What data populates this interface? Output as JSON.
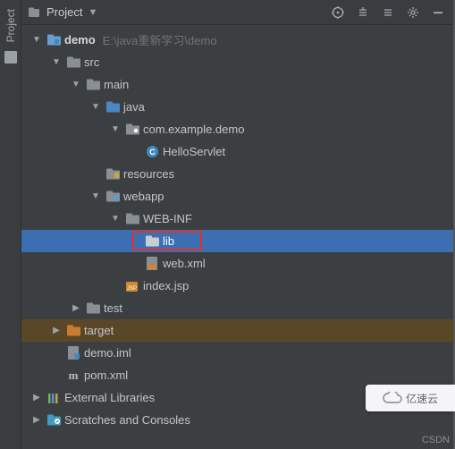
{
  "sidebar_tab": "Project",
  "toolbar": {
    "title": "Project"
  },
  "tree": {
    "root": {
      "name": "demo",
      "path": "E:\\java重新学习\\demo"
    },
    "src": "src",
    "main": "main",
    "java": "java",
    "package": "com.example.demo",
    "class1": "HelloServlet",
    "resources": "resources",
    "webapp": "webapp",
    "webinf": "WEB-INF",
    "lib": "lib",
    "webxml": "web.xml",
    "indexjsp": "index.jsp",
    "test": "test",
    "target": "target",
    "iml": "demo.iml",
    "pom": "pom.xml",
    "extlib": "External Libraries",
    "scratches": "Scratches and Consoles"
  },
  "watermarks": {
    "csdn": "CSDN",
    "cloud": "亿速云"
  },
  "icons": {
    "module": "module-folder",
    "folder": "folder",
    "folder_src": "source-folder",
    "folder_res": "resources-folder",
    "folder_web": "web-folder",
    "folder_target": "target-folder",
    "package": "package",
    "class": "java-class",
    "xml": "xml-file",
    "jsp": "jsp-file",
    "iml": "iml-file",
    "maven": "maven-file",
    "lib": "library",
    "scratch": "scratches"
  },
  "colors": {
    "bg": "#3c3f41",
    "selection": "#3b6fb1",
    "accent_orange": "#c97b2f",
    "accent_blue": "#4a87c7",
    "red_highlight": "#e03030"
  }
}
